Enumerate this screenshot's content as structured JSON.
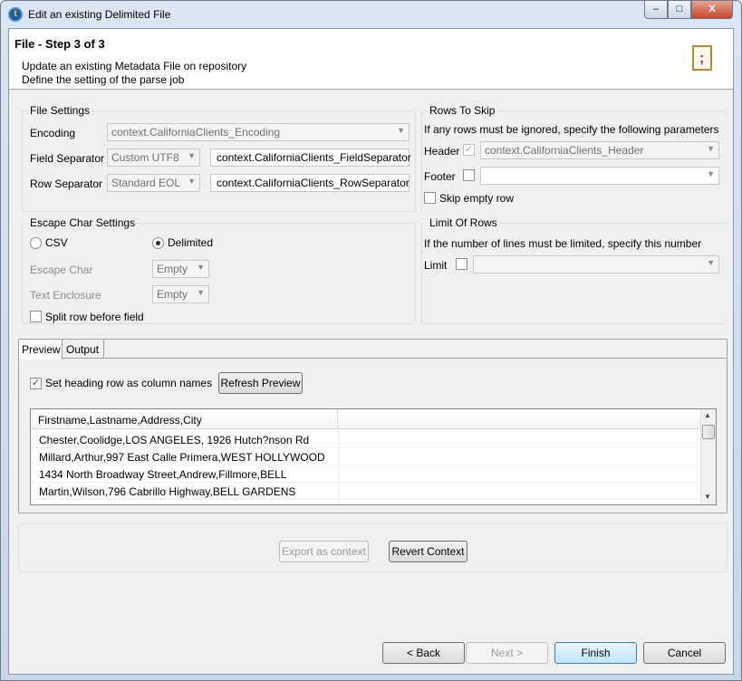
{
  "window": {
    "title": "Edit an existing Delimited File",
    "minimize": "–",
    "maximize": "□",
    "close": "X"
  },
  "header": {
    "step": "File - Step 3 of 3",
    "line1": "Update an existing Metadata File on repository",
    "line2": "Define the setting of the parse job"
  },
  "file_settings": {
    "title": "File Settings",
    "encoding_label": "Encoding",
    "encoding_value": "context.CaliforniaClients_Encoding",
    "field_sep_label": "Field Separator",
    "field_sep_combo": "Custom UTF8",
    "field_sep_value": "context.CaliforniaClients_FieldSeparator",
    "row_sep_label": "Row Separator",
    "row_sep_combo": "Standard EOL",
    "row_sep_value": "context.CaliforniaClients_RowSeparator"
  },
  "rows_to_skip": {
    "title": "Rows To Skip",
    "desc": "If any rows must be ignored, specify the following parameters",
    "header_label": "Header",
    "header_checked": true,
    "header_value": "context.CaliforniaClients_Header",
    "footer_label": "Footer",
    "footer_value": "",
    "skip_empty_label": "Skip empty row"
  },
  "escape": {
    "title": "Escape Char Settings",
    "csv_label": "CSV",
    "delimited_label": "Delimited",
    "selected": "Delimited",
    "escape_char_label": "Escape Char",
    "escape_char_value": "Empty",
    "text_enclosure_label": "Text Enclosure",
    "text_enclosure_value": "Empty",
    "split_row_label": "Split row before field"
  },
  "limit": {
    "title": "Limit Of Rows",
    "desc": "If the number of lines must be limited, specify this number",
    "limit_label": "Limit",
    "limit_value": ""
  },
  "preview": {
    "tabs": [
      "Preview",
      "Output"
    ],
    "active_tab": "Preview",
    "heading_checkbox_label": "Set heading row as column names",
    "heading_checked": true,
    "refresh_button": "Refresh Preview",
    "columns": [
      "Firstname,Lastname,Address,City",
      ""
    ],
    "rows": [
      "Chester,Coolidge,LOS ANGELES, 1926 Hutch?nson Rd",
      "Millard,Arthur,997 East Calle Primera,WEST HOLLYWOOD",
      "1434 North Broadway Street,Andrew,Fillmore,BELL",
      "Martin,Wilson,796 Cabrillo Highway,BELL GARDENS"
    ]
  },
  "context": {
    "export_button": "Export as context",
    "revert_button": "Revert Context"
  },
  "footer": {
    "back": "< Back",
    "next": "Next >",
    "finish": "Finish",
    "cancel": "Cancel"
  }
}
